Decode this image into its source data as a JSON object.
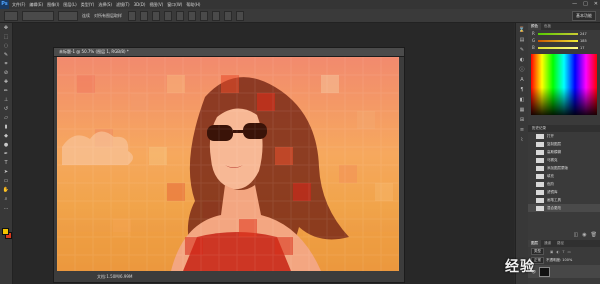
{
  "app": {
    "logo": "Ps"
  },
  "menu": [
    "文件(F)",
    "编辑(E)",
    "图像(I)",
    "图层(L)",
    "类型(Y)",
    "选择(S)",
    "滤镜(T)",
    "3D(D)",
    "视图(V)",
    "窗口(W)",
    "帮助(H)"
  ],
  "window_controls": {
    "minimize": "—",
    "maximize": "□",
    "close": "✕"
  },
  "options_bar": {
    "sample_label": "连续",
    "antialias": "对所有图层取样",
    "workspace": "基本功能"
  },
  "document": {
    "tab_title": "未标题-1 @ 50.7% (图层 1, RGB/8) *",
    "status": "文档:1.50M/6.99M"
  },
  "panels": {
    "color_tabs": [
      "颜色",
      "色板"
    ],
    "rgb": [
      {
        "ch": "R",
        "val": "247"
      },
      {
        "ch": "G",
        "val": "185"
      },
      {
        "ch": "B",
        "val": "17"
      }
    ],
    "history_tabs": [
      "历史记录",
      "动作"
    ],
    "history_items": [
      "打开",
      "复制图层",
      "高斯模糊",
      "马赛克",
      "添加图层蒙版",
      "填充",
      "色阶",
      "滤镜库",
      "画笔工具",
      "混合更改"
    ],
    "history_selected_index": 9,
    "layer_tabs": [
      "图层",
      "通道",
      "路径"
    ],
    "layer_kind": "类型",
    "layer_blend": "正常",
    "layer_opacity": "不透明度: 100%"
  },
  "watermark": "经验",
  "colors": {
    "fg": "#f5c400",
    "bg": "#d93a1d",
    "accent": "#4fa3ff"
  }
}
